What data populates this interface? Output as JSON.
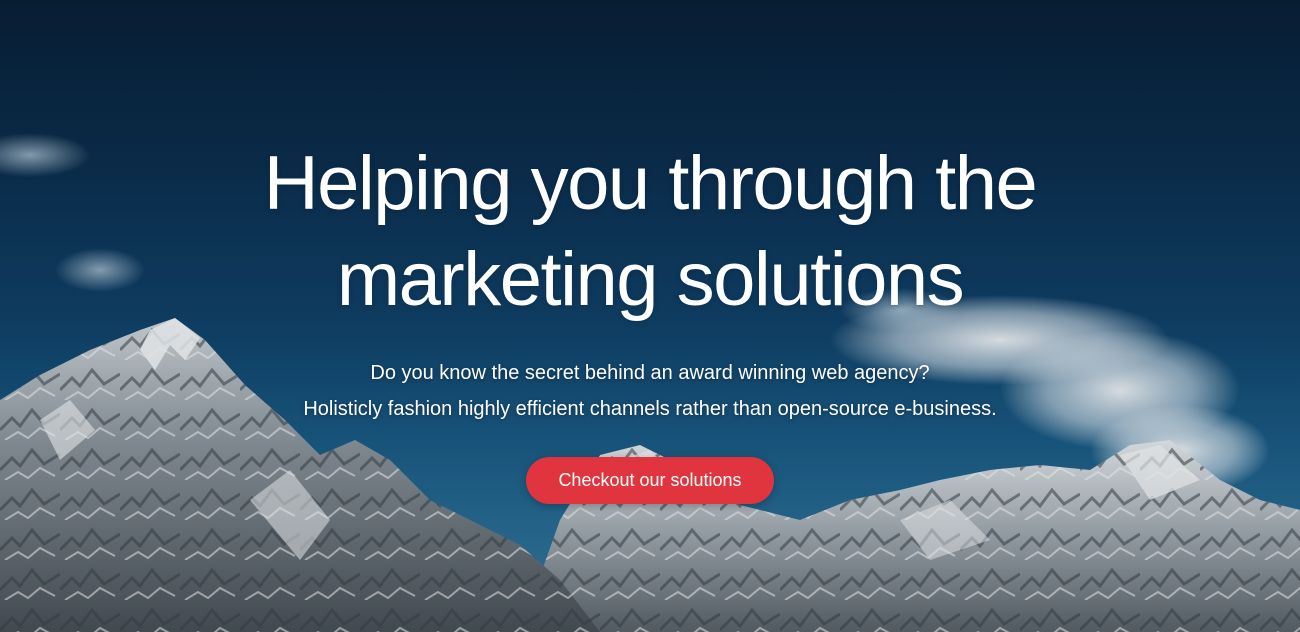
{
  "hero": {
    "headline_line1": "Helping you through the",
    "headline_line2": "marketing solutions",
    "subtext_line1": "Do you know the secret behind an award winning web agency?",
    "subtext_line2": "Holisticly fashion highly efficient channels rather than open-source e-business.",
    "cta_label": "Checkout our solutions",
    "accent_color": "#e0353f",
    "background": "mountain-snow-sky-photo"
  }
}
